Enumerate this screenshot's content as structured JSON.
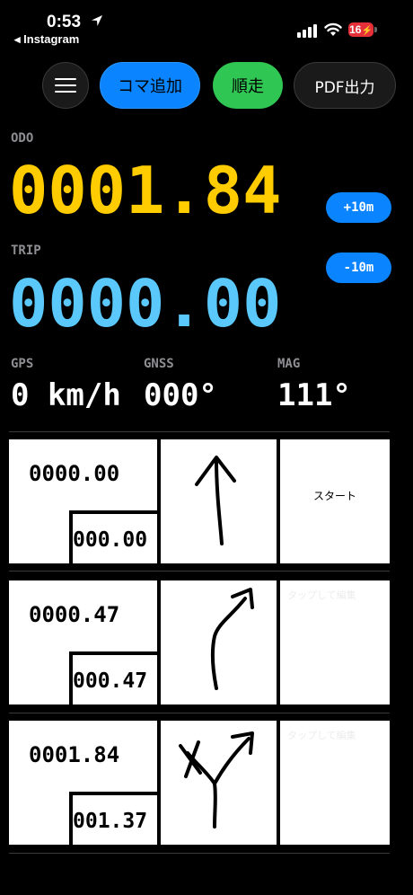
{
  "status_bar": {
    "time": "0:53",
    "back_app": "◂ Instagram",
    "battery": "16"
  },
  "toolbar": {
    "add_koma_label": "コマ追加",
    "junso_label": "順走",
    "pdf_label": "PDF出力"
  },
  "odo": {
    "label": "ODO",
    "value": "0001.84",
    "plus_button": "+10m"
  },
  "trip": {
    "label": "TRIP",
    "value": "0000.00",
    "minus_button": "-10m"
  },
  "sensors": {
    "gps_label": "GPS",
    "gps_value": "0 km/h",
    "gnss_label": "GNSS",
    "gnss_value": "000°",
    "mag_label": "MAG",
    "mag_value": "111°"
  },
  "koma": [
    {
      "total": "0000.00",
      "interval": "000.00",
      "arrow": "straight-arrow-icon",
      "note": "スタート",
      "note_placeholder": ""
    },
    {
      "total": "0000.47",
      "interval": "000.47",
      "arrow": "curve-right-arrow-icon",
      "note": "",
      "note_placeholder": "タップして編集"
    },
    {
      "total": "0001.84",
      "interval": "001.37",
      "arrow": "fork-arrow-icon",
      "note": "",
      "note_placeholder": "タップして編集"
    }
  ],
  "colors": {
    "odo": "#ffcc00",
    "trip": "#5ac8fa",
    "accent_blue": "#0a84ff",
    "accent_green": "#30c653"
  }
}
